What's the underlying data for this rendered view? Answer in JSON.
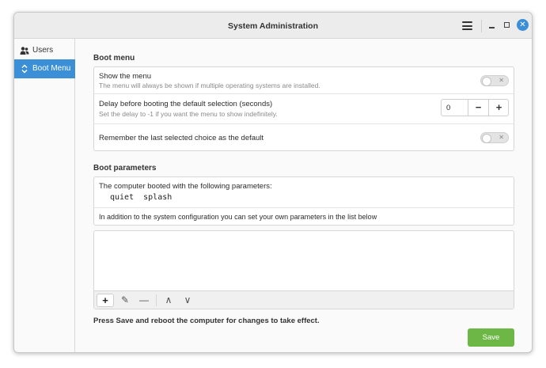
{
  "window": {
    "title": "System Administration",
    "controls": {
      "menu": "hamburger-icon",
      "minimize": "minimize-icon",
      "maximize": "maximize-icon",
      "close": "close-icon"
    }
  },
  "sidebar": {
    "items": [
      {
        "label": "Users",
        "icon": "users-icon",
        "selected": false
      },
      {
        "label": "Boot Menu",
        "icon": "boot-menu-icon",
        "selected": true
      }
    ]
  },
  "boot_menu": {
    "section_title": "Boot menu",
    "show_menu": {
      "title": "Show the menu",
      "subtitle": "The menu will always be shown if multiple operating systems are installed.",
      "enabled": false
    },
    "delay": {
      "title": "Delay before booting the default selection (seconds)",
      "subtitle": "Set the delay to -1 if you want the menu to show indefinitely.",
      "value": "0",
      "minus_label": "−",
      "plus_label": "+"
    },
    "remember": {
      "title": "Remember the last selected choice as the default",
      "enabled": false
    }
  },
  "boot_parameters": {
    "section_title": "Boot parameters",
    "intro": "The computer booted with the following parameters:",
    "params": "quiet  splash",
    "info": "In addition to the system configuration you can set your own parameters in the list below",
    "toolbar": {
      "add": "+",
      "edit": "✎",
      "remove": "—",
      "up": "∧",
      "down": "∨"
    }
  },
  "footer": {
    "note": "Press Save and reboot the computer for changes to take effect.",
    "save_label": "Save"
  },
  "colors": {
    "accent": "#3a8fd6",
    "save": "#6cb745"
  }
}
